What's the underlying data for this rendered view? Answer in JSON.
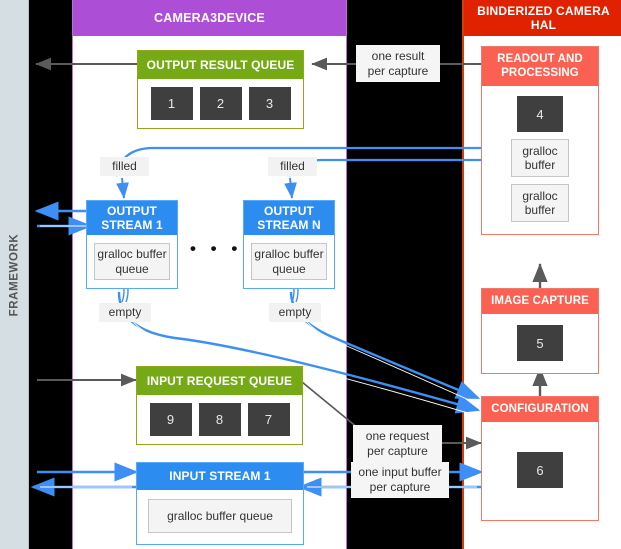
{
  "diagram": {
    "title": "Camera3Device / Binderized Camera HAL data flow",
    "colors": {
      "framework_bg": "#d4dee3",
      "camera3device_header": "#ad4fd6",
      "hal_header": "#e02200",
      "queue_green": "#76a916",
      "stream_blue": "#2d8cf0",
      "hal_card_red": "#fa6152",
      "chip_dark": "#3f3f3f",
      "blue_arrow": "#3d8ef5",
      "gray_arrow": "#5a5a5a",
      "background": "#000000"
    }
  },
  "framework": {
    "label": "FRAMEWORK"
  },
  "camera3device": {
    "header": "CAMERA3DEVICE",
    "output_result_queue": {
      "title": "OUTPUT RESULT QUEUE",
      "chips": [
        "1",
        "2",
        "3"
      ]
    },
    "output_stream_1": {
      "title": "OUTPUT\nSTREAM 1",
      "inner": "gralloc\nbuffer queue",
      "filled_label": "filled",
      "empty_label": "empty"
    },
    "output_stream_n": {
      "title": "OUTPUT\nSTREAM N",
      "inner": "gralloc\nbuffer queue",
      "filled_label": "filled",
      "empty_label": "empty"
    },
    "ellipsis": "• • •",
    "input_request_queue": {
      "title": "INPUT REQUEST QUEUE",
      "chips": [
        "9",
        "8",
        "7"
      ]
    },
    "input_stream_1": {
      "title": "INPUT STREAM 1",
      "inner": "gralloc buffer queue"
    }
  },
  "hal": {
    "header": "BINDERIZED CAMERA\nHAL",
    "readout_and_processing": {
      "title": "READOUT AND\nPROCESSING",
      "chip": "4",
      "buffers": [
        "gralloc\nbuffer",
        "gralloc\nbuffer"
      ]
    },
    "image_capture": {
      "title": "IMAGE CAPTURE",
      "chip": "5"
    },
    "configuration": {
      "title": "CONFIGURATION",
      "chip": "6"
    }
  },
  "annotations": {
    "one_result_per_capture": "one result\nper capture",
    "one_request_per_capture": "one request\nper capture",
    "one_input_buffer_per_capture": "one input buffer\nper capture"
  }
}
